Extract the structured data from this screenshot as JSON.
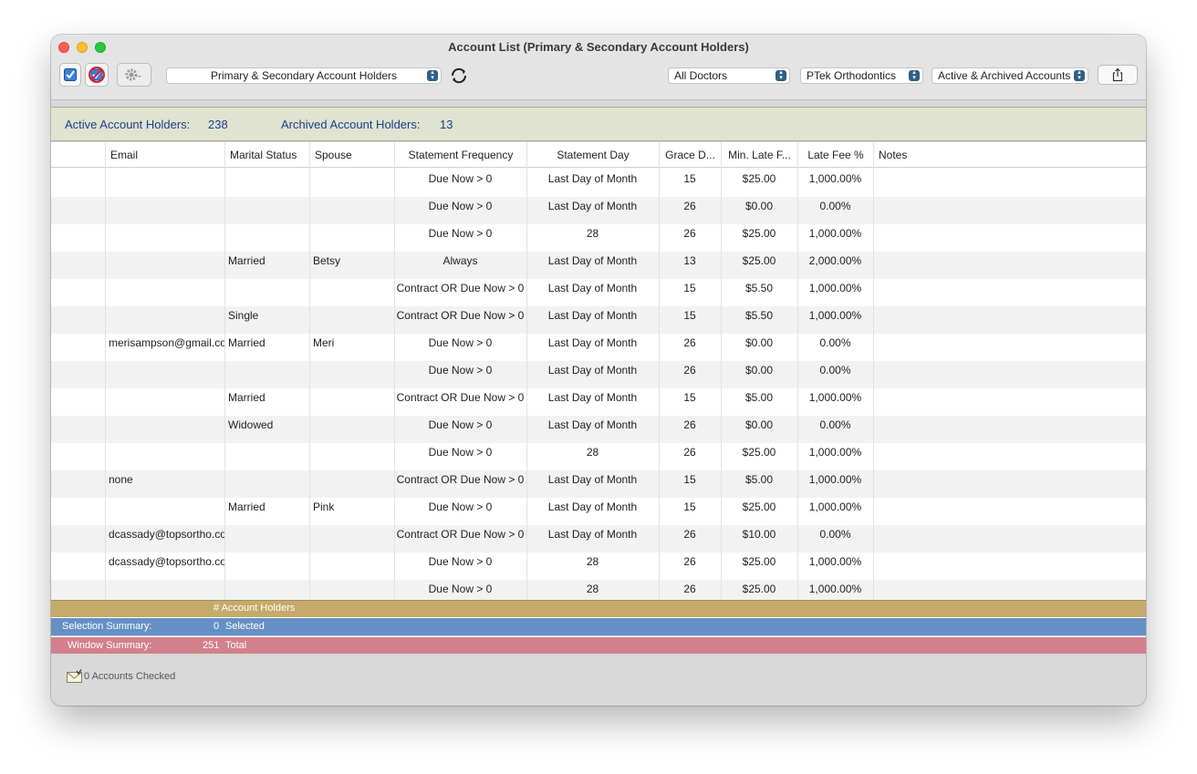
{
  "window": {
    "title": "Account List (Primary & Secondary Account Holders)"
  },
  "toolbar": {
    "list_select": "Primary & Secondary Account Holders",
    "doctors": "All Doctors",
    "practice": "PTek Orthodontics",
    "accounts_filter": "Active & Archived Accounts"
  },
  "summary": {
    "active_label": "Active Account Holders:",
    "active_count": "238",
    "archived_label": "Archived Account Holders:",
    "archived_count": "13"
  },
  "columns": [
    "Email",
    "Marital Status",
    "Spouse",
    "Statement Frequency",
    "Statement Day",
    "Grace D...",
    "Min. Late F...",
    "Late Fee %",
    "Notes"
  ],
  "rows": [
    [
      "",
      "",
      "",
      "Due Now > 0",
      "Last Day of Month",
      "15",
      "$25.00",
      "1,000.00%",
      ""
    ],
    [
      "",
      "",
      "",
      "Due Now > 0",
      "Last Day of Month",
      "26",
      "$0.00",
      "0.00%",
      ""
    ],
    [
      "",
      "",
      "",
      "Due Now > 0",
      "28",
      "26",
      "$25.00",
      "1,000.00%",
      ""
    ],
    [
      "",
      "Married",
      "Betsy",
      "Always",
      "Last Day of Month",
      "13",
      "$25.00",
      "2,000.00%",
      ""
    ],
    [
      "",
      "",
      "",
      "Contract OR Due Now > 0",
      "Last Day of Month",
      "15",
      "$5.50",
      "1,000.00%",
      ""
    ],
    [
      "",
      "Single",
      "",
      "Contract OR Due Now > 0",
      "Last Day of Month",
      "15",
      "$5.50",
      "1,000.00%",
      ""
    ],
    [
      "merisampson@gmail.co",
      "Married",
      "Meri",
      "Due Now > 0",
      "Last Day of Month",
      "26",
      "$0.00",
      "0.00%",
      ""
    ],
    [
      "",
      "",
      "",
      "Due Now > 0",
      "Last Day of Month",
      "26",
      "$0.00",
      "0.00%",
      ""
    ],
    [
      "",
      "Married",
      "",
      "Contract OR Due Now > 0",
      "Last Day of Month",
      "15",
      "$5.00",
      "1,000.00%",
      ""
    ],
    [
      "",
      "Widowed",
      "",
      "Due Now > 0",
      "Last Day of Month",
      "26",
      "$0.00",
      "0.00%",
      ""
    ],
    [
      "",
      "",
      "",
      "Due Now > 0",
      "28",
      "26",
      "$25.00",
      "1,000.00%",
      ""
    ],
    [
      "none",
      "",
      "",
      "Contract OR Due Now > 0",
      "Last Day of Month",
      "15",
      "$5.00",
      "1,000.00%",
      ""
    ],
    [
      "",
      "Married",
      "Pink",
      "Due Now > 0",
      "Last Day of Month",
      "15",
      "$25.00",
      "1,000.00%",
      ""
    ],
    [
      "dcassady@topsortho.co",
      "",
      "",
      "Contract OR Due Now > 0",
      "Last Day of Month",
      "26",
      "$10.00",
      "0.00%",
      ""
    ],
    [
      "dcassady@topsortho.co",
      "",
      "",
      "Due Now > 0",
      "28",
      "26",
      "$25.00",
      "1,000.00%",
      ""
    ],
    [
      "",
      "",
      "",
      "Due Now > 0",
      "28",
      "26",
      "$25.00",
      "1,000.00%",
      ""
    ]
  ],
  "footer": {
    "account_holders_label": "# Account Holders",
    "selection_label": "Selection Summary:",
    "selection_count": "0",
    "selection_suffix": "Selected",
    "window_label": "Window Summary:",
    "window_count": "251",
    "window_suffix": "Total"
  },
  "status": {
    "text": "0 Accounts Checked"
  },
  "colors": {
    "gold_bar": "#c6aa6a",
    "blue_bar": "#6590c6",
    "red_bar": "#d37f8c",
    "summary_bg": "#dfe3cf",
    "summary_text": "#1b3f8b"
  }
}
